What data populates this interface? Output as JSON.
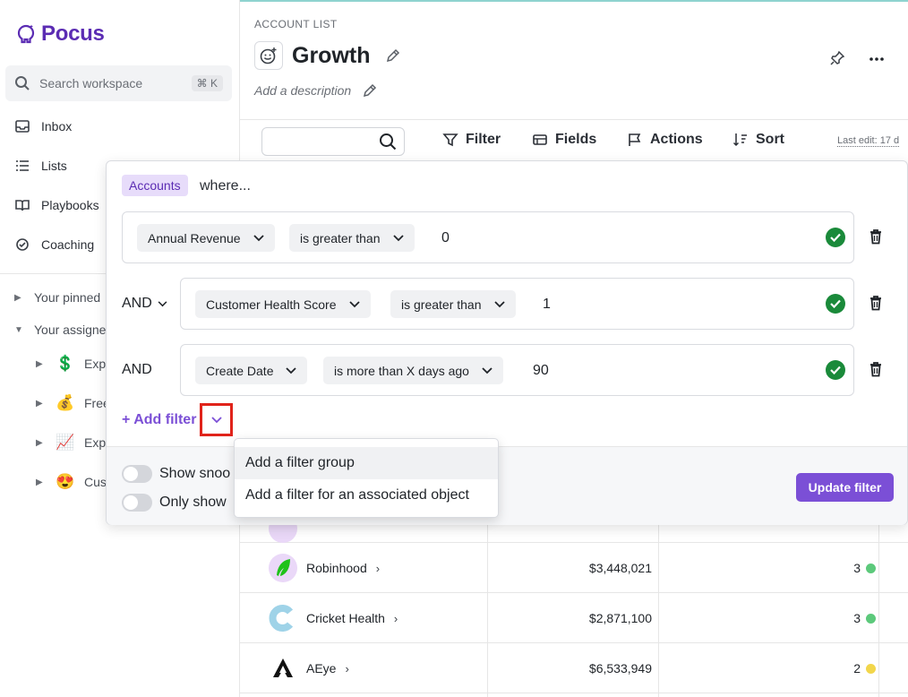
{
  "app": {
    "name": "Pocus",
    "brand_color": "#5b2cb3",
    "accent_color": "#7b4fd6"
  },
  "sidebar": {
    "search": {
      "placeholder": "Search workspace",
      "shortcut": "⌘ K"
    },
    "nav": [
      {
        "label": "Inbox",
        "icon": "inbox-icon"
      },
      {
        "label": "Lists",
        "icon": "list-icon"
      },
      {
        "label": "Playbooks",
        "icon": "book-icon"
      },
      {
        "label": "Coaching",
        "icon": "coaching-icon"
      }
    ],
    "sections": [
      {
        "label": "Your pinned",
        "expanded": false
      },
      {
        "label": "Your assigne",
        "expanded": true
      }
    ],
    "lists": [
      {
        "emoji": "💲",
        "label": "Exp"
      },
      {
        "emoji": "💰",
        "label": "Free"
      },
      {
        "emoji": "📈",
        "label": "Exp"
      },
      {
        "emoji": "😍",
        "label": "Cus"
      }
    ]
  },
  "header": {
    "breadcrumb": "ACCOUNT LIST",
    "title": "Growth",
    "description_placeholder": "Add a description"
  },
  "toolbar": {
    "filter": "Filter",
    "fields": "Fields",
    "actions": "Actions",
    "sort": "Sort",
    "last_edit": "Last edit: 17 d"
  },
  "filter_panel": {
    "object_tag": "Accounts",
    "where": "where...",
    "conditions": [
      {
        "conjunction": "",
        "field": "Annual Revenue",
        "operator": "is greater than",
        "value": "0"
      },
      {
        "conjunction": "AND",
        "field": "Customer Health Score",
        "operator": "is greater than",
        "value": "1"
      },
      {
        "conjunction": "AND",
        "field": "Create Date",
        "operator": "is more than X days ago",
        "value": "90"
      }
    ],
    "add_filter": "+ Add filter",
    "toggles": [
      {
        "label": "Show snoo",
        "on": false
      },
      {
        "label": "Only show",
        "on": false
      }
    ],
    "update_button": "Update filter"
  },
  "add_filter_menu": {
    "items": [
      "Add a filter group",
      "Add a filter for an associated object"
    ]
  },
  "table": {
    "rows": [
      {
        "name": "Robinhood",
        "amount": "$3,448,021",
        "score": "3",
        "status_color": "#5cc97b"
      },
      {
        "name": "Cricket Health",
        "amount": "$2,871,100",
        "score": "3",
        "status_color": "#5cc97b"
      },
      {
        "name": "AEye",
        "amount": "$6,533,949",
        "score": "2",
        "status_color": "#f2d64b"
      }
    ]
  }
}
